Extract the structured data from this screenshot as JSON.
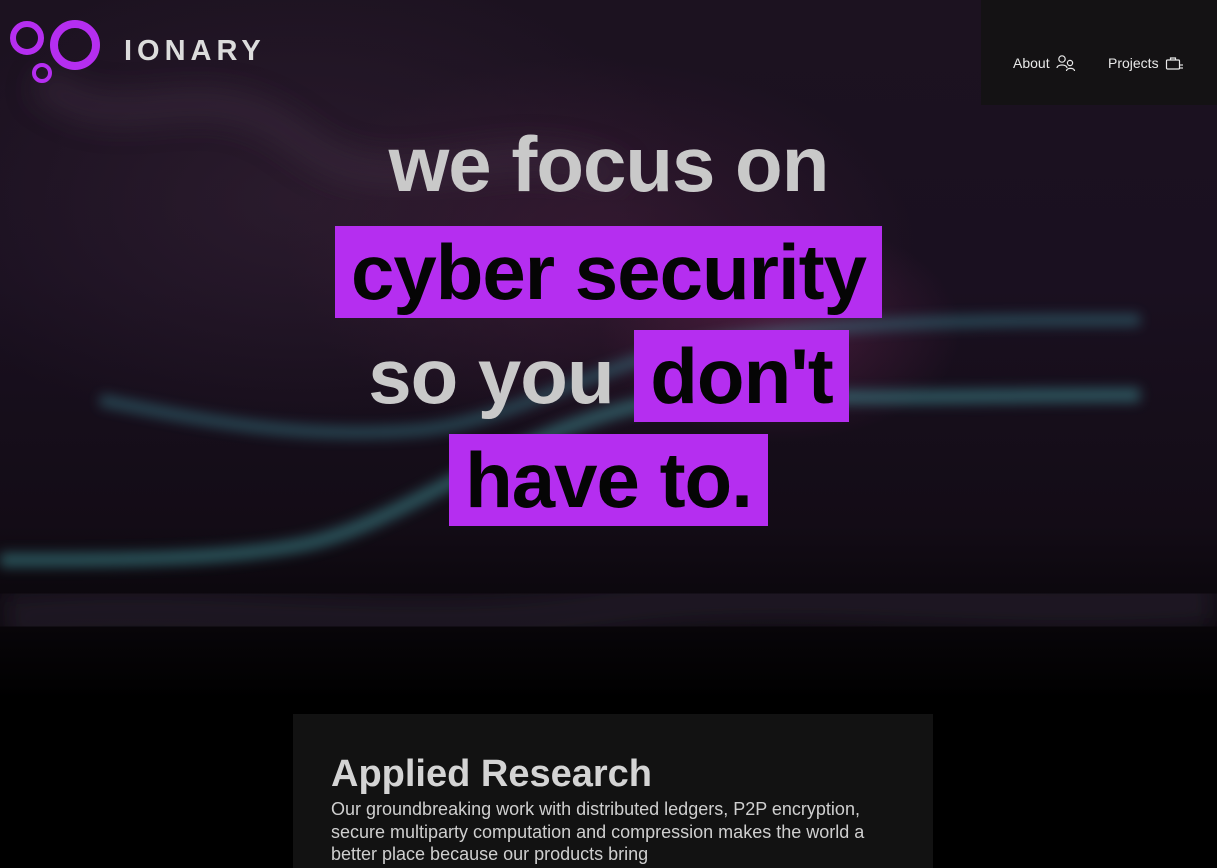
{
  "brand": {
    "name": "IONARY",
    "logo_icon": "three-circles-logo",
    "accent_color": "#b52ef0"
  },
  "nav": {
    "items": [
      {
        "label": "About",
        "icon": "users-icon"
      },
      {
        "label": "Projects",
        "icon": "briefcase-icon"
      }
    ]
  },
  "hero": {
    "line1": "we focus on",
    "line2_highlight": "cyber security",
    "line3_plain": "so you",
    "line3_highlight": "don't",
    "line4_highlight": "have to."
  },
  "research_card": {
    "title": "Applied Research",
    "body": "Our groundbreaking work with distributed ledgers, P2P encryption, secure multiparty computation and compression makes the world a better place because our products bring"
  }
}
